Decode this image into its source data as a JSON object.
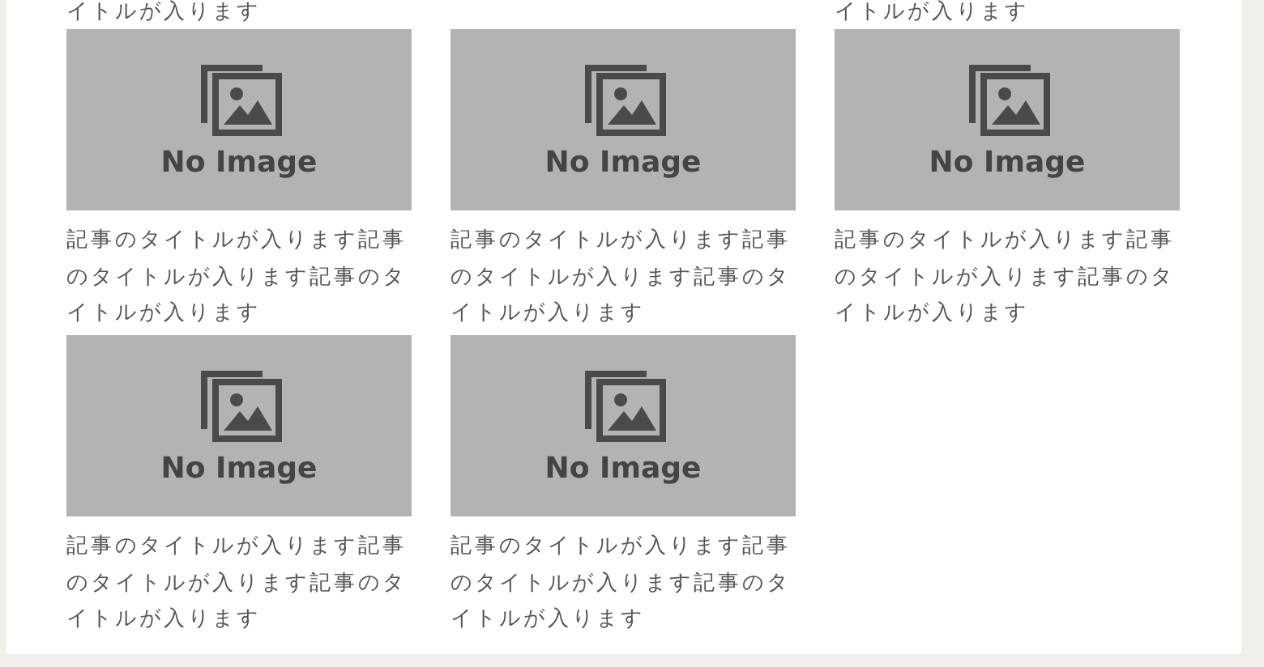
{
  "cut_captions": [
    {
      "kind": "caption",
      "text": "イトルが入ります"
    },
    {
      "kind": "blank"
    },
    {
      "kind": "caption",
      "text": "イトルが入ります"
    }
  ],
  "articles": [
    {
      "thumbnail": {
        "kind": "placeholder",
        "label": "No Image"
      },
      "title": "記事のタイトルが入ります記事のタイトルが入ります記事のタイトルが入ります"
    },
    {
      "thumbnail": {
        "kind": "placeholder",
        "label": "No Image"
      },
      "title": "記事のタイトルが入ります記事のタイトルが入ります記事のタイトルが入ります"
    },
    {
      "thumbnail": {
        "kind": "placeholder",
        "label": "No Image"
      },
      "title": "記事のタイトルが入ります記事のタイトルが入ります記事のタイトルが入ります"
    },
    {
      "thumbnail": {
        "kind": "placeholder",
        "label": "No Image"
      },
      "title": "記事のタイトルが入ります記事のタイトルが入ります記事のタイトルが入ります"
    },
    {
      "thumbnail": {
        "kind": "placeholder",
        "label": "No Image"
      },
      "title": "記事のタイトルが入ります記事のタイトルが入ります記事のタイトルが入ります"
    }
  ]
}
